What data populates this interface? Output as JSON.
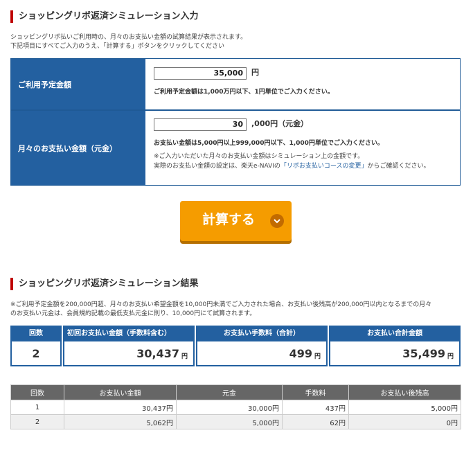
{
  "input_section": {
    "title": "ショッピングリボ返済シミュレーション入力",
    "desc_line1": "ショッピングリボ払いご利用時の、月々のお支払い金額の試算結果が表示されます。",
    "desc_line2": "下記項目にすべてご入力のうえ、「計算する」ボタンをクリックしてください"
  },
  "form": {
    "usage_label": "ご利用予定金額",
    "usage_value": "35,000",
    "usage_unit": "円",
    "usage_note": "ご利用予定金額は1,000万円以下、1円単位でご入力ください。",
    "monthly_label": "月々のお支払い金額（元金）",
    "monthly_value": "30",
    "monthly_unit": ",000円（元金）",
    "monthly_note": "お支払い金額は5,000円以上999,000円以下、1,000円単位でご入力ください。",
    "monthly_note2": "※ご入力いただいた月々のお支払い金額はシミュレーション上の金額です。",
    "monthly_note3_prefix": "実際のお支払い金額の設定は、楽天e-NAVIの",
    "monthly_note3_link": "「リボお支払いコースの変更」",
    "monthly_note3_suffix": "からご確認ください。"
  },
  "calc_button": {
    "label": "計算する",
    "icon": "chevron-down-icon"
  },
  "result_section": {
    "title": "ショッピングリボ返済シミュレーション結果",
    "desc_line1": "※ご利用予定金額を200,000円超、月々のお支払い希望金額を10,000円未満でご入力された場合、お支払い後残高が200,000円以内となるまでの月々",
    "desc_line2": "のお支払い元金は、会員規約記載の最低支払元金に則り、10,000円にて試算されます。"
  },
  "summary": {
    "headers": [
      "回数",
      "初回お支払い金額（手数料含む）",
      "お支払い手数料（合計）",
      "お支払い合計金額"
    ],
    "count": "2",
    "first_payment": "30,437",
    "total_fee": "499",
    "total_amount": "35,499",
    "yen": "円"
  },
  "history": {
    "headers": [
      "回数",
      "お支払い金額",
      "元金",
      "手数料",
      "お支払い後残高"
    ],
    "rows": [
      [
        "1",
        "30,437円",
        "30,000円",
        "437円",
        "5,000円"
      ],
      [
        "2",
        "5,062円",
        "5,000円",
        "62円",
        "0円"
      ]
    ]
  },
  "colors": {
    "accent_red": "#bf0000",
    "header_blue": "#2360a0",
    "button_orange": "#f59c00"
  }
}
